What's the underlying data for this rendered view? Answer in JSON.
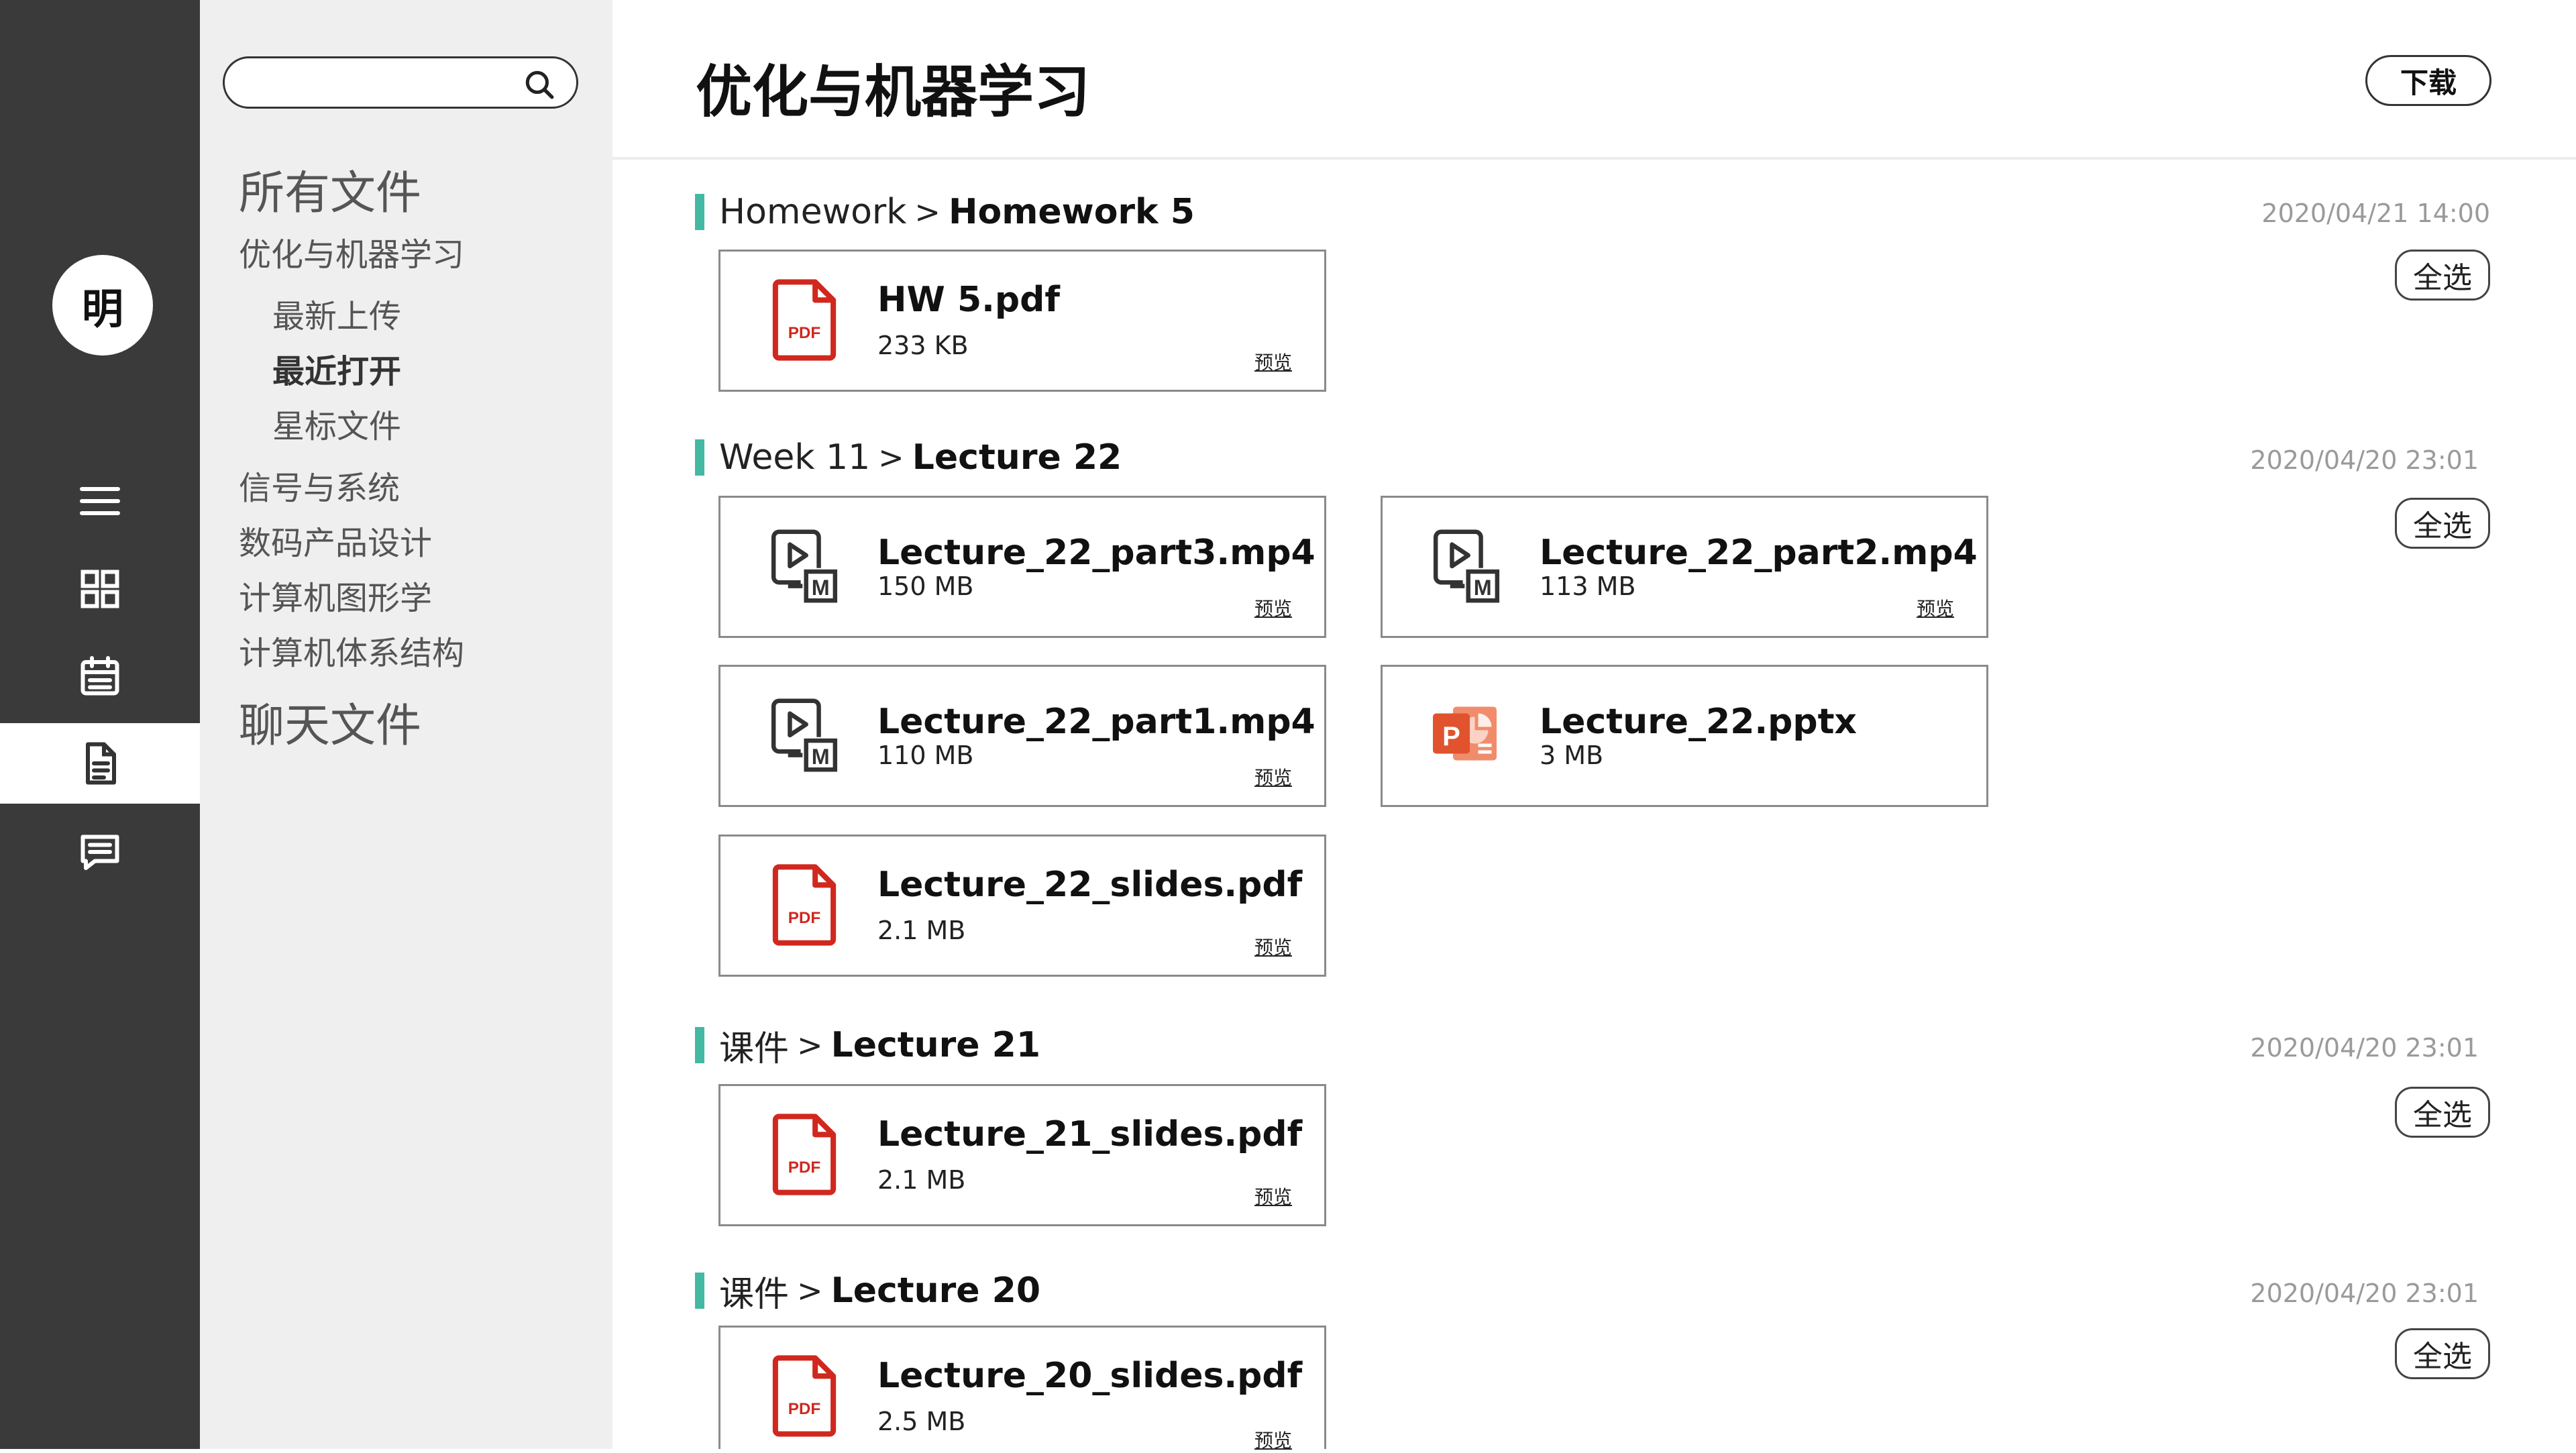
{
  "user": {
    "avatar_char": "明"
  },
  "rail": {
    "items": [
      {
        "icon": "menu-icon",
        "active": false
      },
      {
        "icon": "grid-icon",
        "active": false
      },
      {
        "icon": "calendar-icon",
        "active": false
      },
      {
        "icon": "document-icon",
        "active": true
      },
      {
        "icon": "chat-icon",
        "active": false
      }
    ]
  },
  "search": {
    "placeholder": "",
    "icon": "search-icon"
  },
  "nav": {
    "all_files": "所有文件",
    "current_course": "优化与机器学习",
    "sub_items": [
      "最新上传",
      "最近打开",
      "星标文件"
    ],
    "active_sub": "最近打开",
    "courses": [
      "信号与系统",
      "数码产品设计",
      "计算机图形学",
      "计算机体系结构"
    ],
    "chat_files": "聊天文件"
  },
  "header": {
    "title": "优化与机器学习",
    "download_label": "下载"
  },
  "colors": {
    "accent_bar": "#43b8a2",
    "pdf_red": "#d0281f",
    "pptx_orange": "#e0532e",
    "rail_bg": "#3a3a3a"
  },
  "select_all_label": "全选",
  "preview_label": "预览",
  "sep": ">",
  "groups": [
    {
      "parent": "Homework",
      "current": "Homework 5",
      "date": "2020/04/21  14:00",
      "files": [
        {
          "name": "HW 5.pdf",
          "size": "233 KB",
          "type": "pdf",
          "preview": true
        }
      ]
    },
    {
      "parent": "Week 11",
      "current": "Lecture 22",
      "date": "2020/04/20 23:01",
      "files": [
        {
          "name": "Lecture_22_part3.mp4",
          "size": "150 MB",
          "type": "video",
          "preview": true
        },
        {
          "name": "Lecture_22_part2.mp4",
          "size": "113 MB",
          "type": "video",
          "preview": true
        },
        {
          "name": "Lecture_22_part1.mp4",
          "size": "110 MB",
          "type": "video",
          "preview": true
        },
        {
          "name": "Lecture_22.pptx",
          "size": "3 MB",
          "type": "pptx",
          "preview": false
        },
        {
          "name": "Lecture_22_slides.pdf",
          "size": "2.1 MB",
          "type": "pdf",
          "preview": true
        }
      ]
    },
    {
      "parent": "课件",
      "current": "Lecture 21",
      "date": "2020/04/20 23:01",
      "files": [
        {
          "name": "Lecture_21_slides.pdf",
          "size": "2.1 MB",
          "type": "pdf",
          "preview": true
        }
      ]
    },
    {
      "parent": "课件",
      "current": "Lecture 20",
      "date": "2020/04/20 23:01",
      "files": [
        {
          "name": "Lecture_20_slides.pdf",
          "size": "2.5 MB",
          "type": "pdf",
          "preview": true
        }
      ]
    }
  ]
}
